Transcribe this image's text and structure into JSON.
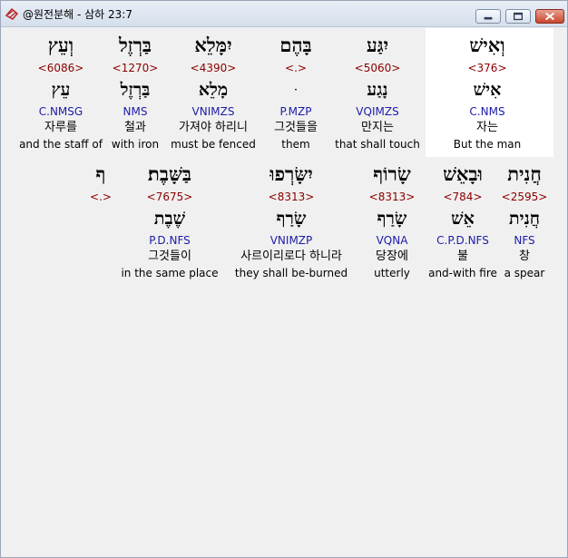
{
  "window": {
    "title": "@원전분해 - 삼하 23:7",
    "colors": {
      "strong": "#8b0000",
      "morph": "#1c1ca8",
      "selected_bg": "#ffffff"
    }
  },
  "rows": [
    {
      "words": [
        {
          "heb": "וְעֵץ",
          "strong": "<6086>",
          "lemma": "עֵץ",
          "morph": "C.NMSG",
          "kor": "자루를",
          "eng": "and the staff of"
        },
        {
          "heb": "בַּרְזֶל",
          "strong": "<1270>",
          "lemma": "בַּרְזֶל",
          "morph": "NMS",
          "kor": "철과",
          "eng": "with iron"
        },
        {
          "heb": "יִמָּלֵא",
          "strong": "<4390>",
          "lemma": "מָלֵא",
          "morph": "VNIMZS",
          "kor": "가져야 하리니",
          "eng": "must  be fenced"
        },
        {
          "heb": "בָּהֶם",
          "strong": "<.>",
          "lemma": "ּ",
          "morph": "P.MZP",
          "kor": "그것들을",
          "eng": "them"
        },
        {
          "heb": "יִגַּע",
          "strong": "<5060>",
          "lemma": "נָגַע",
          "morph": "VQIMZS",
          "kor": "만지는",
          "eng": "that shall touch"
        },
        {
          "heb": "וְאִישׁ",
          "strong": "<376>",
          "lemma": "אִישׁ",
          "morph": "C.NMS",
          "kor": "자는",
          "eng": "But the man",
          "selected": true
        }
      ]
    },
    {
      "words": [
        {
          "heb": "ף",
          "strong": "<.>",
          "lemma": "",
          "morph": "",
          "kor": "",
          "eng": ""
        },
        {
          "heb": "בַּשָּׁבֶת׃",
          "strong": "<7675>",
          "lemma": "שֶׁבֶת",
          "morph": "P.D.NFS",
          "kor": "그것들이",
          "eng": "in the same place"
        },
        {
          "heb": "יִשָּׂרְפוּ",
          "strong": "<8313>",
          "lemma": "שָׂרַף",
          "morph": "VNIMZP",
          "kor": "사르이리로다 하니라",
          "eng": "they shall be-burned"
        },
        {
          "heb": "שָׂרוֹף",
          "strong": "<8313>",
          "lemma": "שָׂרַף",
          "morph": "VQNA",
          "kor": "당장에",
          "eng": "utterly"
        },
        {
          "heb": "וּבָאֵשׁ",
          "strong": "<784>",
          "lemma": "אֵשׁ",
          "morph": "C.P.D.NFS",
          "kor": "불",
          "eng": "and-with fire"
        },
        {
          "heb": "חֲנִית",
          "strong": "<2595>",
          "lemma": "חֲנִית",
          "morph": "NFS",
          "kor": "창",
          "eng": "a spear"
        }
      ]
    }
  ]
}
